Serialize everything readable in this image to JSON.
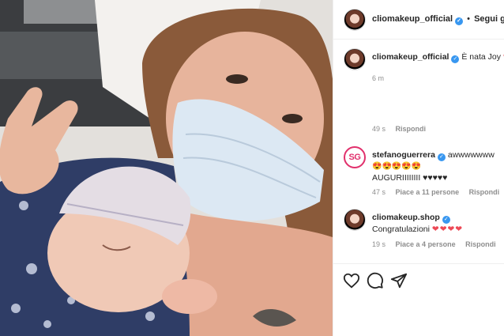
{
  "post": {
    "author": "cliomakeup_official",
    "separator": "•",
    "follow_label": "Segui già"
  },
  "caption": {
    "author": "cliomakeup_official",
    "text": "È nata Joy",
    "heart": "❤",
    "time": "6 m"
  },
  "comments": [
    {
      "author": "",
      "text": "",
      "time": "49 s",
      "likes": "",
      "reply": "Rispondi"
    },
    {
      "author": "stefanoguerrera",
      "avatar_initials": "SG",
      "text_line1": "awwwwwww",
      "emojis": "😍😍😍😍😍",
      "text_line2": "AUGURIIIIIIII ♥♥♥♥♥",
      "time": "47 s",
      "likes": "Piace a 11 persone",
      "reply": "Rispondi"
    },
    {
      "author": "cliomakeup.shop",
      "text": "Congratulazioni",
      "hearts": "❤❤❤❤",
      "time": "19 s",
      "likes": "Piace a 4 persone",
      "reply": "Rispondi"
    }
  ],
  "actions": {
    "like_icon": "heart-outline",
    "comment_icon": "speech-bubble",
    "share_icon": "paper-plane"
  },
  "colors": {
    "verified": "#3897f0",
    "heart": "#ed4956",
    "meta": "#8e8e8e"
  }
}
